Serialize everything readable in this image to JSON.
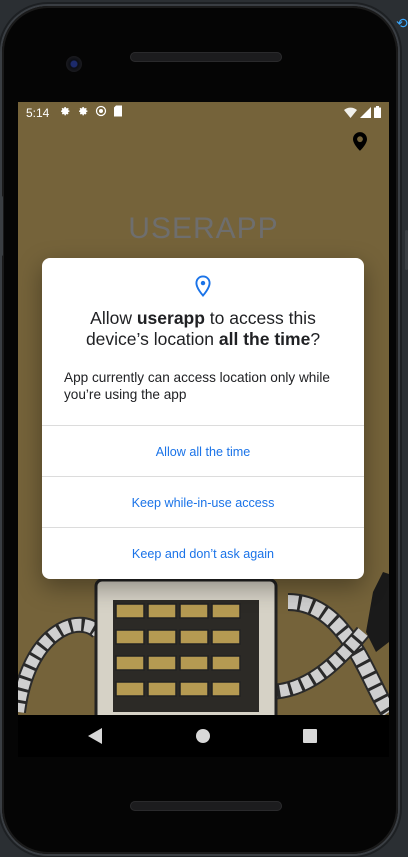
{
  "status_bar": {
    "time": "5:14",
    "left_icons": [
      "settings-icon",
      "settings-icon",
      "sync-icon",
      "sd-card-icon"
    ],
    "right_icons": [
      "wifi-icon",
      "signal-icon",
      "battery-icon"
    ]
  },
  "app": {
    "title": "USERAPP",
    "location_marker": "location-pin-icon",
    "background_color": "#75633a"
  },
  "dialog": {
    "icon": "location-pin-icon",
    "title_prefix": "Allow ",
    "title_app": "userapp",
    "title_middle": " to access this device’s location ",
    "title_emphasis": "all the time",
    "title_suffix": "?",
    "body": "App currently can access location only while you’re using the app",
    "buttons": [
      {
        "label": "Allow all the time"
      },
      {
        "label": "Keep while-in-use access"
      },
      {
        "label": "Keep and don’t ask again"
      }
    ],
    "accent_color": "#1a73e8"
  },
  "nav_bar": {
    "back": "back-icon",
    "home": "home-icon",
    "recents": "recents-icon"
  }
}
